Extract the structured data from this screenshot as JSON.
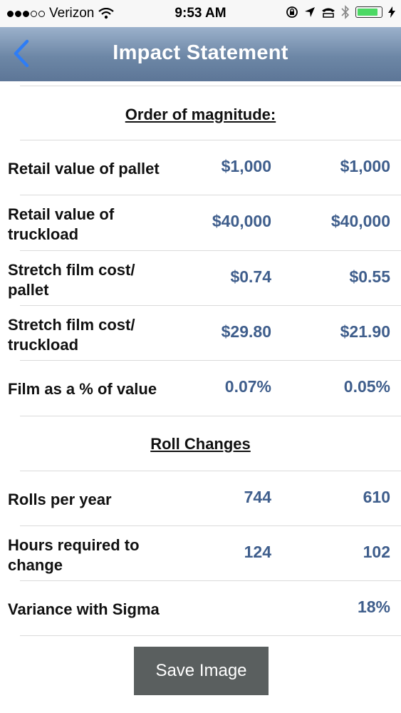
{
  "status_bar": {
    "carrier": "Verizon",
    "time": "9:53 AM",
    "battery_level": 0.9
  },
  "nav": {
    "back_icon": "chevron-left-icon",
    "title": "Impact Statement"
  },
  "sections": {
    "order_title": "Order of magnitude:",
    "roll_title": "Roll Changes"
  },
  "rows": [
    {
      "label": "Retail value of pallet",
      "v1": "$1,000",
      "v2": "$1,000"
    },
    {
      "label": "Retail value of truckload",
      "v1": "$40,000",
      "v2": "$40,000"
    },
    {
      "label": "Stretch film cost/ pallet",
      "v1": "$0.74",
      "v2": "$0.55"
    },
    {
      "label": "Stretch film cost/ truckload",
      "v1": "$29.80",
      "v2": "$21.90"
    },
    {
      "label": "Film as a % of value",
      "v1": "0.07%",
      "v2": "0.05%"
    },
    {
      "label": "Rolls per year",
      "v1": "744",
      "v2": "610"
    },
    {
      "label": "Hours required to change",
      "v1": "124",
      "v2": "102"
    },
    {
      "label": "Variance with Sigma",
      "v1": "",
      "v2": "18%"
    }
  ],
  "save_button": {
    "label": "Save Image"
  },
  "colors": {
    "nav_gradient": "#6d87a6",
    "value_text": "#3f5e8c",
    "back_icon": "#2e7df6",
    "button_bg": "#5a5f5f"
  }
}
